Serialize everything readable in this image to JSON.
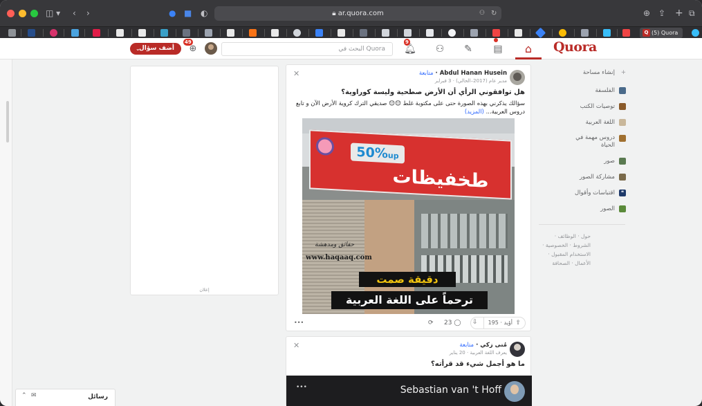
{
  "browser": {
    "url": "ar.quora.com",
    "active_tab_label": "(5) Quora"
  },
  "header": {
    "logo": "Quora",
    "search_placeholder": "البحث في Quora",
    "ask_button": "أضف سؤال",
    "notifications_badge": "9",
    "languages_badge": "49"
  },
  "sidebar": {
    "create_space": "إنشاء مساحة",
    "items": [
      {
        "label": "الفلسفة",
        "color": "#4a6a8a"
      },
      {
        "label": "توصيات الكتب",
        "color": "#8a5a2a"
      },
      {
        "label": "اللغة العربية",
        "color": "#c9b79a"
      },
      {
        "label": "دروس مهمة في الحياة",
        "color": "#a07030"
      },
      {
        "label": "صور",
        "color": "#5a7a50"
      },
      {
        "label": "مشاركة الصور",
        "color": "#7a6a4a"
      },
      {
        "label": "اقتباسات وأقوال",
        "color": "#1e3a6a"
      },
      {
        "label": "الصور",
        "color": "#5a8a3a"
      }
    ],
    "footer_line1": "حول · الوظائف ·",
    "footer_line2": "الشروط · الخصوصية ·",
    "footer_line3": "الاستخدام المقبول ·",
    "footer_line4": "الأعمال · الصحافة"
  },
  "ad": {
    "label": "إعلان"
  },
  "post1": {
    "author": "Abdul Hanan Husein",
    "follow": "متابعة",
    "credential": "مدير عام (2017–الحالي) · 3 فبراير",
    "question": "هل توافقوني الرأي أن الأرض صطحية وليسة كوراوية؟",
    "excerpt": "سؤالك يذكرني بهذه الصورة حتى على مكتوبة غلط 😊😊 صديقي الترك كروية الأرض الآن و تابع دروس العربية...",
    "more": "(المزيد)",
    "image_banner_percent": "50%",
    "image_banner_up": "up",
    "image_banner_text": "طخفيظات",
    "image_watermark_ar": "حقائق ومدهشة",
    "image_watermark_url": "www.haqaaq.com",
    "image_caption1": "دقيقة صمت",
    "image_caption2": "ترحماً على اللغة العربية",
    "upvote_label": "أؤيد · 195",
    "comments": "23",
    "more_dots": "•••"
  },
  "post2": {
    "author": "مُنى زكي",
    "follow": "متابعة",
    "credential": "يعرف اللغة العربية · 20 يناير",
    "question": "ما هو أجمل شيء قد قرأته؟",
    "video_title": "Sebastian van 't Hoff",
    "more_dots": "•••"
  },
  "messages": {
    "label": "رسائل"
  }
}
